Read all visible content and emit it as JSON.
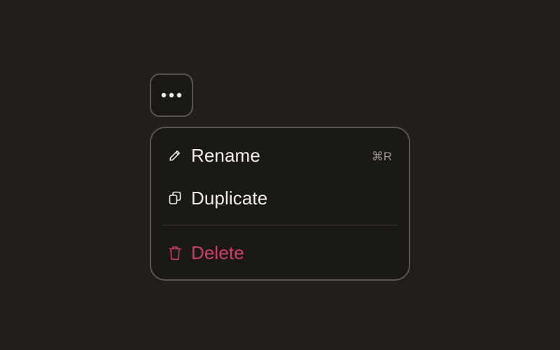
{
  "trigger": {
    "icon": "more-horizontal-icon"
  },
  "menu": {
    "items": [
      {
        "label": "Rename",
        "icon": "pencil-icon",
        "shortcut": "⌘R"
      },
      {
        "label": "Duplicate",
        "icon": "copy-icon",
        "shortcut": ""
      },
      {
        "label": "Delete",
        "icon": "trash-icon",
        "shortcut": "",
        "destructive": true
      }
    ]
  },
  "colors": {
    "background": "#221f1a",
    "surface": "#1a1916",
    "border": "#5a554d",
    "text": "#f2efe8",
    "muted": "#9a958b",
    "danger": "#d23f66"
  }
}
